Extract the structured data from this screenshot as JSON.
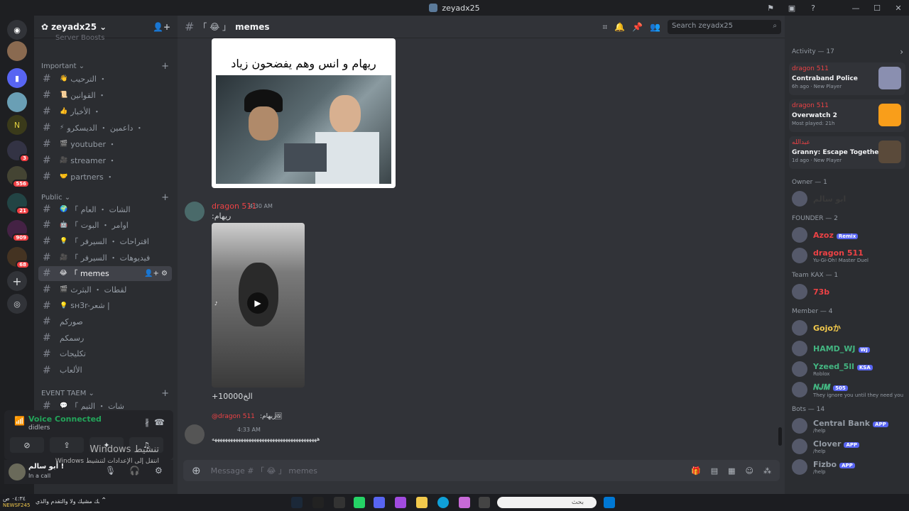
{
  "window": {
    "title": "zeyadx25"
  },
  "servers": {
    "badges": [
      "3",
      "556",
      "21",
      "909",
      "68"
    ]
  },
  "guild": {
    "name": "zeyadx25",
    "server_boosts": "Server Boosts"
  },
  "categories": {
    "important": "Important",
    "public": "Public",
    "event_team": "EVENT TAEM"
  },
  "channels_important": [
    {
      "icon": "👋",
      "label": "الترحيب ・"
    },
    {
      "icon": "📜",
      "label": "القوانين ・"
    },
    {
      "icon": "👍",
      "label": "الأخبار ・"
    },
    {
      "icon": "⚡",
      "label": "داعمين ・ الديسكرو ・"
    },
    {
      "icon": "🎬",
      "label": "youtuber ・"
    },
    {
      "icon": "🎥",
      "label": "streamer ・"
    },
    {
      "icon": "🤝",
      "label": "partners ・"
    }
  ],
  "channels_public": [
    {
      "icon": "🌍",
      "label": "「 الشات ・ العام"
    },
    {
      "icon": "🤖",
      "label": "「 اوامر ・ البوت"
    },
    {
      "icon": "💡",
      "label": "「 اقتراحات ・ السيرفر"
    },
    {
      "icon": "🎥",
      "label": "「 فيديوهات ・ السيرفر"
    },
    {
      "icon": "😂",
      "label": "「 memes"
    },
    {
      "icon": "🎬",
      "label": "لقطات ・ البثرث"
    },
    {
      "icon": "💡",
      "label": "sн3r-شعر |"
    },
    {
      "icon": "",
      "label": "صوركم"
    },
    {
      "icon": "",
      "label": "رسمكم"
    },
    {
      "icon": "",
      "label": "تكليجات"
    },
    {
      "icon": "",
      "label": "الألعاب"
    }
  ],
  "channels_event": [
    {
      "icon": "💬",
      "label": "「 شات ・ التيم"
    }
  ],
  "voice": {
    "status": "Voice Connected",
    "channel": "didlers"
  },
  "user": {
    "name": "أبو سالم !",
    "status": "In a call"
  },
  "header": {
    "channel_name": "memes",
    "channel_prefix": "「 😂 」",
    "search_placeholder": "Search zeyadx25"
  },
  "messages": [
    {
      "meme_caption": "ريهام و انس وهم يفضحون زياد"
    },
    {
      "author": "dragon 511",
      "time": "4:30 AM",
      "text": "ريهام:",
      "below": "+10000الخ"
    },
    {
      "reply_author": "@dragon 511",
      "reply_text": "ريهام:",
      "time": "4:33 AM",
      "text": "ههههههههههههههههههههههههههههههههههههههههه"
    }
  ],
  "composer": {
    "placeholder": "Message # 「 😂 」 memes"
  },
  "members_panel": {
    "activity_header": "Activity — 17",
    "activities": [
      {
        "name": "dragon 511",
        "game": "Contraband Police",
        "sub": "6h ago  ·  New Player",
        "color": "#8a8fb0"
      },
      {
        "name": "dragon 511",
        "game": "Overwatch 2",
        "sub": "Most played: 21h",
        "color": "#f99e1a"
      },
      {
        "name": "عبدالله",
        "game": "Granny: Escape Together",
        "sub": "1d ago  ·  New Player",
        "color": "#5a4a3a"
      }
    ],
    "groups": [
      {
        "header": "Owner — 1",
        "members": [
          {
            "name": "ابو سالم",
            "sub": "",
            "color": "#3a3a3a",
            "tag": ""
          }
        ]
      },
      {
        "header": "FOUNDER — 2",
        "members": [
          {
            "name": "Azoz",
            "sub": "",
            "color": "#ed4245",
            "tag": "Remix"
          },
          {
            "name": "dragon 511",
            "sub": "Yu-Gi-Oh! Master Duel",
            "color": "#ed4245",
            "tag": ""
          }
        ]
      },
      {
        "header": "Team KAX — 1",
        "members": [
          {
            "name": "73b",
            "sub": "",
            "color": "#ed4245",
            "tag": ""
          }
        ]
      },
      {
        "header": "Member — 4",
        "members": [
          {
            "name": "Gojoか",
            "sub": "",
            "color": "#f2c94c",
            "tag": ""
          },
          {
            "name": "HAMD_WJ",
            "sub": "",
            "color": "#43b581",
            "tag": "WJ"
          },
          {
            "name": "Yzeed_5ll",
            "sub": "Roblox",
            "color": "#43b581",
            "tag": "KSA"
          },
          {
            "name": "𝑵𝑱𝑴",
            "sub": "They ignore you until they need you",
            "color": "#43b581",
            "tag": "505"
          }
        ]
      },
      {
        "header": "Bots — 14",
        "members": [
          {
            "name": "Central Bank",
            "sub": "/help",
            "color": "#949ba4",
            "tag": "APP"
          },
          {
            "name": "Clover",
            "sub": "/help",
            "color": "#949ba4",
            "tag": "APP"
          },
          {
            "name": "Fizbo",
            "sub": "/help",
            "color": "#949ba4",
            "tag": "APP"
          }
        ]
      }
    ]
  },
  "watermark": {
    "line1": "تنشيط Windows",
    "line2": "انتقل إلى الإعدادات لتنشيط Windows"
  },
  "taskbar": {
    "search": "بحث",
    "clock": "٠٤:٣٤ ص",
    "tray_text": "واطيبك مشيك ولا والتقدم والذي",
    "news": "NEWSF245"
  }
}
